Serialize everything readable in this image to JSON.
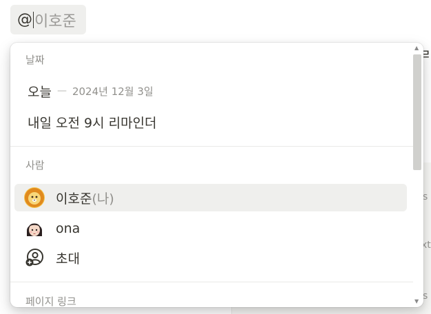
{
  "mention": {
    "at": "@",
    "query": "이호준"
  },
  "background": {
    "char_right": "ㄹ",
    "frag1": "s",
    "frag2": "xt",
    "frag3": "s"
  },
  "popup": {
    "date_section": {
      "label": "날짜",
      "today_label": "오늘",
      "today_dash": "—",
      "today_date": "2024년 12월 3일",
      "reminder": "내일 오전 9시 리마인더"
    },
    "people_section": {
      "label": "사람",
      "items": [
        {
          "name": "이호준",
          "suffix": "(나)",
          "avatar": "lion-avatar-icon",
          "selected": true
        },
        {
          "name": "ona",
          "suffix": "",
          "avatar": "girl-avatar-icon",
          "selected": false
        },
        {
          "name": "초대",
          "suffix": "",
          "avatar": "invite-person-icon",
          "selected": false
        }
      ]
    },
    "page_link_section": {
      "label": "페이지 링크"
    }
  }
}
